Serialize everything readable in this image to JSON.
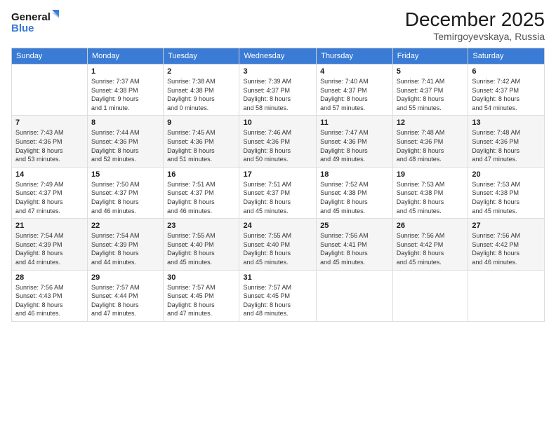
{
  "logo": {
    "line1": "General",
    "line2": "Blue"
  },
  "title": "December 2025",
  "subtitle": "Temirgoyevskaya, Russia",
  "weekdays": [
    "Sunday",
    "Monday",
    "Tuesday",
    "Wednesday",
    "Thursday",
    "Friday",
    "Saturday"
  ],
  "weeks": [
    [
      {
        "day": "",
        "info": ""
      },
      {
        "day": "1",
        "info": "Sunrise: 7:37 AM\nSunset: 4:38 PM\nDaylight: 9 hours\nand 1 minute."
      },
      {
        "day": "2",
        "info": "Sunrise: 7:38 AM\nSunset: 4:38 PM\nDaylight: 9 hours\nand 0 minutes."
      },
      {
        "day": "3",
        "info": "Sunrise: 7:39 AM\nSunset: 4:37 PM\nDaylight: 8 hours\nand 58 minutes."
      },
      {
        "day": "4",
        "info": "Sunrise: 7:40 AM\nSunset: 4:37 PM\nDaylight: 8 hours\nand 57 minutes."
      },
      {
        "day": "5",
        "info": "Sunrise: 7:41 AM\nSunset: 4:37 PM\nDaylight: 8 hours\nand 55 minutes."
      },
      {
        "day": "6",
        "info": "Sunrise: 7:42 AM\nSunset: 4:37 PM\nDaylight: 8 hours\nand 54 minutes."
      }
    ],
    [
      {
        "day": "7",
        "info": "Sunrise: 7:43 AM\nSunset: 4:36 PM\nDaylight: 8 hours\nand 53 minutes."
      },
      {
        "day": "8",
        "info": "Sunrise: 7:44 AM\nSunset: 4:36 PM\nDaylight: 8 hours\nand 52 minutes."
      },
      {
        "day": "9",
        "info": "Sunrise: 7:45 AM\nSunset: 4:36 PM\nDaylight: 8 hours\nand 51 minutes."
      },
      {
        "day": "10",
        "info": "Sunrise: 7:46 AM\nSunset: 4:36 PM\nDaylight: 8 hours\nand 50 minutes."
      },
      {
        "day": "11",
        "info": "Sunrise: 7:47 AM\nSunset: 4:36 PM\nDaylight: 8 hours\nand 49 minutes."
      },
      {
        "day": "12",
        "info": "Sunrise: 7:48 AM\nSunset: 4:36 PM\nDaylight: 8 hours\nand 48 minutes."
      },
      {
        "day": "13",
        "info": "Sunrise: 7:48 AM\nSunset: 4:36 PM\nDaylight: 8 hours\nand 47 minutes."
      }
    ],
    [
      {
        "day": "14",
        "info": "Sunrise: 7:49 AM\nSunset: 4:37 PM\nDaylight: 8 hours\nand 47 minutes."
      },
      {
        "day": "15",
        "info": "Sunrise: 7:50 AM\nSunset: 4:37 PM\nDaylight: 8 hours\nand 46 minutes."
      },
      {
        "day": "16",
        "info": "Sunrise: 7:51 AM\nSunset: 4:37 PM\nDaylight: 8 hours\nand 46 minutes."
      },
      {
        "day": "17",
        "info": "Sunrise: 7:51 AM\nSunset: 4:37 PM\nDaylight: 8 hours\nand 45 minutes."
      },
      {
        "day": "18",
        "info": "Sunrise: 7:52 AM\nSunset: 4:38 PM\nDaylight: 8 hours\nand 45 minutes."
      },
      {
        "day": "19",
        "info": "Sunrise: 7:53 AM\nSunset: 4:38 PM\nDaylight: 8 hours\nand 45 minutes."
      },
      {
        "day": "20",
        "info": "Sunrise: 7:53 AM\nSunset: 4:38 PM\nDaylight: 8 hours\nand 45 minutes."
      }
    ],
    [
      {
        "day": "21",
        "info": "Sunrise: 7:54 AM\nSunset: 4:39 PM\nDaylight: 8 hours\nand 44 minutes."
      },
      {
        "day": "22",
        "info": "Sunrise: 7:54 AM\nSunset: 4:39 PM\nDaylight: 8 hours\nand 44 minutes."
      },
      {
        "day": "23",
        "info": "Sunrise: 7:55 AM\nSunset: 4:40 PM\nDaylight: 8 hours\nand 45 minutes."
      },
      {
        "day": "24",
        "info": "Sunrise: 7:55 AM\nSunset: 4:40 PM\nDaylight: 8 hours\nand 45 minutes."
      },
      {
        "day": "25",
        "info": "Sunrise: 7:56 AM\nSunset: 4:41 PM\nDaylight: 8 hours\nand 45 minutes."
      },
      {
        "day": "26",
        "info": "Sunrise: 7:56 AM\nSunset: 4:42 PM\nDaylight: 8 hours\nand 45 minutes."
      },
      {
        "day": "27",
        "info": "Sunrise: 7:56 AM\nSunset: 4:42 PM\nDaylight: 8 hours\nand 46 minutes."
      }
    ],
    [
      {
        "day": "28",
        "info": "Sunrise: 7:56 AM\nSunset: 4:43 PM\nDaylight: 8 hours\nand 46 minutes."
      },
      {
        "day": "29",
        "info": "Sunrise: 7:57 AM\nSunset: 4:44 PM\nDaylight: 8 hours\nand 47 minutes."
      },
      {
        "day": "30",
        "info": "Sunrise: 7:57 AM\nSunset: 4:45 PM\nDaylight: 8 hours\nand 47 minutes."
      },
      {
        "day": "31",
        "info": "Sunrise: 7:57 AM\nSunset: 4:45 PM\nDaylight: 8 hours\nand 48 minutes."
      },
      {
        "day": "",
        "info": ""
      },
      {
        "day": "",
        "info": ""
      },
      {
        "day": "",
        "info": ""
      }
    ]
  ]
}
